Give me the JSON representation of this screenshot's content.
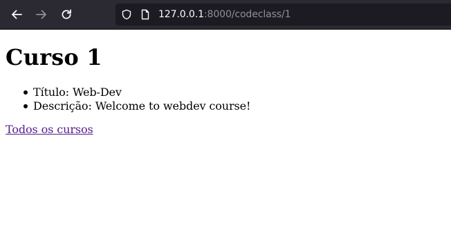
{
  "browser": {
    "url_host": "127.0.0.1",
    "url_path": ":8000/codeclass/1",
    "nav_icons": [
      "back-arrow-icon",
      "forward-arrow-icon",
      "reload-icon",
      "shield-icon",
      "page-icon"
    ],
    "toolbar_color": "#2b2a33",
    "urlbar_color": "#1c1b22"
  },
  "page": {
    "heading": "Curso 1",
    "details": [
      {
        "label": "Título:",
        "value": "Web-Dev"
      },
      {
        "label": "Descrição:",
        "value": "Welcome to webdev course!"
      }
    ],
    "all_courses_link": "Todos os cursos",
    "link_color": "#551a8b"
  }
}
